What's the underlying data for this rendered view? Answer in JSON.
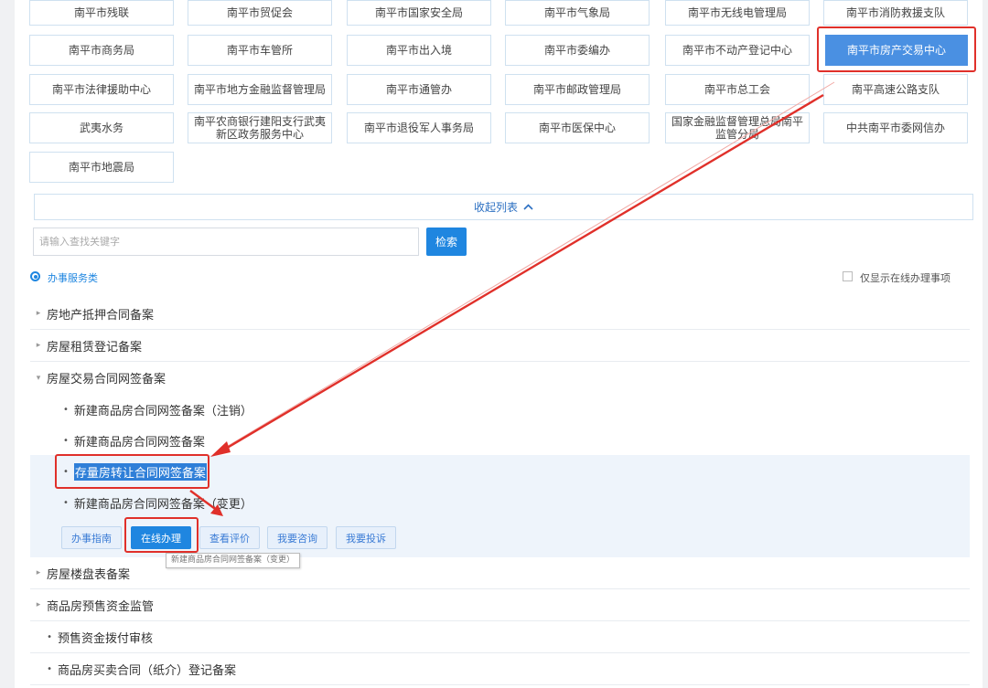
{
  "departments": [
    [
      "南平市残联",
      "南平市贸促会",
      "南平市国家安全局",
      "南平市气象局",
      "南平市无线电管理局",
      "南平市消防救援支队"
    ],
    [
      "南平市商务局",
      "南平市车管所",
      "南平市出入境",
      "南平市委编办",
      "南平市不动产登记中心",
      "南平市房产交易中心"
    ],
    [
      "南平市法律援助中心",
      "南平市地方金融监督管理局",
      "南平市通管办",
      "南平市邮政管理局",
      "南平市总工会",
      "南平高速公路支队"
    ],
    [
      "武夷水务",
      "南平农商银行建阳支行武夷新区政务服务中心",
      "南平市退役军人事务局",
      "南平市医保中心",
      "国家金融监督管理总局南平监管分局",
      "中共南平市委网信办"
    ],
    [
      "南平市地震局"
    ]
  ],
  "collapse_label": "收起列表",
  "search": {
    "placeholder": "请输入查找关键字",
    "button": "检索"
  },
  "filter": {
    "category": "办事服务类",
    "online_only": "仅显示在线办理事项"
  },
  "items": {
    "i1": "房地产抵押合同备案",
    "i2": "房屋租赁登记备案",
    "i3": "房屋交易合同网签备案",
    "i3_subs": [
      "新建商品房合同网签备案（注销）",
      "新建商品房合同网签备案",
      "存量房转让合同网签备案",
      "新建商品房合同网签备案（变更）"
    ],
    "i4": "房屋楼盘表备案",
    "i5": "商品房预售资金监管",
    "i5_subs": [
      "预售资金拨付审核",
      "商品房买卖合同（纸介）登记备案"
    ]
  },
  "actions": {
    "guide": "办事指南",
    "online": "在线办理",
    "review": "查看评价",
    "consult": "我要咨询",
    "complain": "我要投诉"
  },
  "tooltip": "新建商品房合同网签备案（变更）",
  "colors": {
    "accent": "#1f86e0",
    "highlight": "#e0302a",
    "active_dept": "#4a90e2"
  }
}
